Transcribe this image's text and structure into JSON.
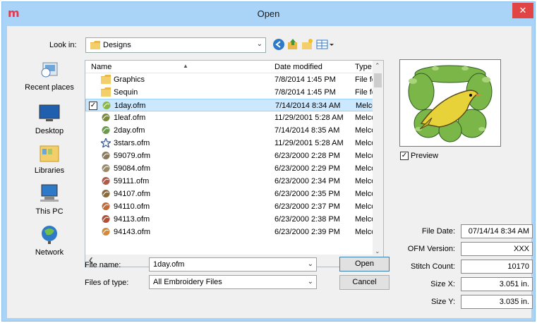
{
  "window": {
    "title": "Open",
    "close_glyph": "✕",
    "app_glyph": "m"
  },
  "toolbar": {
    "lookin_label": "Look in:",
    "lookin_value": "Designs",
    "icons": [
      "back-icon",
      "up-folder-icon",
      "new-folder-icon",
      "view-menu-icon"
    ]
  },
  "places": [
    {
      "label": "Recent places",
      "icon": "recent-places-icon"
    },
    {
      "label": "Desktop",
      "icon": "desktop-icon"
    },
    {
      "label": "Libraries",
      "icon": "libraries-icon"
    },
    {
      "label": "This PC",
      "icon": "this-pc-icon"
    },
    {
      "label": "Network",
      "icon": "network-icon"
    }
  ],
  "list": {
    "columns": [
      "Name",
      "Date modified",
      "Type"
    ],
    "rows": [
      {
        "name": "Graphics",
        "date": "7/8/2014 1:45 PM",
        "type": "File fol",
        "icon": "folder-icon",
        "icon_color": "#e8b84a"
      },
      {
        "name": "Sequin",
        "date": "7/8/2014 1:45 PM",
        "type": "File fol",
        "icon": "folder-icon",
        "icon_color": "#e8b84a"
      },
      {
        "name": "1day.ofm",
        "date": "7/14/2014 8:34 AM",
        "type": "Melco",
        "icon": "design-icon",
        "icon_color": "#8ab54a",
        "selected": true
      },
      {
        "name": "1leaf.ofm",
        "date": "11/29/2001 5:28 AM",
        "type": "Melco",
        "icon": "design-icon",
        "icon_color": "#7a8a3a"
      },
      {
        "name": "2day.ofm",
        "date": "7/14/2014 8:35 AM",
        "type": "Melco",
        "icon": "design-icon",
        "icon_color": "#6a9a4a"
      },
      {
        "name": "3stars.ofm",
        "date": "11/29/2001 5:28 AM",
        "type": "Melco",
        "icon": "star-icon",
        "icon_color": "#3a5a9a"
      },
      {
        "name": "59079.ofm",
        "date": "6/23/2000 2:28 PM",
        "type": "Melco",
        "icon": "design-icon",
        "icon_color": "#8a7a5a"
      },
      {
        "name": "59084.ofm",
        "date": "6/23/2000 2:29 PM",
        "type": "Melco",
        "icon": "design-icon",
        "icon_color": "#9a8a6a"
      },
      {
        "name": "59111.ofm",
        "date": "6/23/2000 2:34 PM",
        "type": "Melco",
        "icon": "design-icon",
        "icon_color": "#b05a4a"
      },
      {
        "name": "94107.ofm",
        "date": "6/23/2000 2:35 PM",
        "type": "Melco",
        "icon": "design-icon",
        "icon_color": "#8a6a3a"
      },
      {
        "name": "94110.ofm",
        "date": "6/23/2000 2:37 PM",
        "type": "Melco",
        "icon": "design-icon",
        "icon_color": "#c06a3a"
      },
      {
        "name": "94113.ofm",
        "date": "6/23/2000 2:38 PM",
        "type": "Melco",
        "icon": "design-icon",
        "icon_color": "#b0503a"
      },
      {
        "name": "94143.ofm",
        "date": "6/23/2000 2:39 PM",
        "type": "Melco",
        "icon": "design-icon",
        "icon_color": "#d08a3a"
      }
    ]
  },
  "form": {
    "filename_label": "File name:",
    "filename_value": "1day.ofm",
    "filetype_label": "Files of type:",
    "filetype_value": "All Embroidery Files",
    "open_label": "Open",
    "cancel_label": "Cancel"
  },
  "preview": {
    "label": "Preview",
    "checked": true
  },
  "info": [
    {
      "label": "File Date:",
      "value": "07/14/14 8:34 AM"
    },
    {
      "label": "OFM Version:",
      "value": "XXX"
    },
    {
      "label": "Stitch Count:",
      "value": "10170"
    },
    {
      "label": "Size X:",
      "value": "3.051 in."
    },
    {
      "label": "Size Y:",
      "value": "3.035 in."
    }
  ],
  "colors": {
    "title_bg": "#a9d4f7",
    "close_bg": "#e04444",
    "selected_row": "#cce8ff",
    "accent_green": "#7ab648",
    "bird_yellow": "#e8d23a"
  }
}
